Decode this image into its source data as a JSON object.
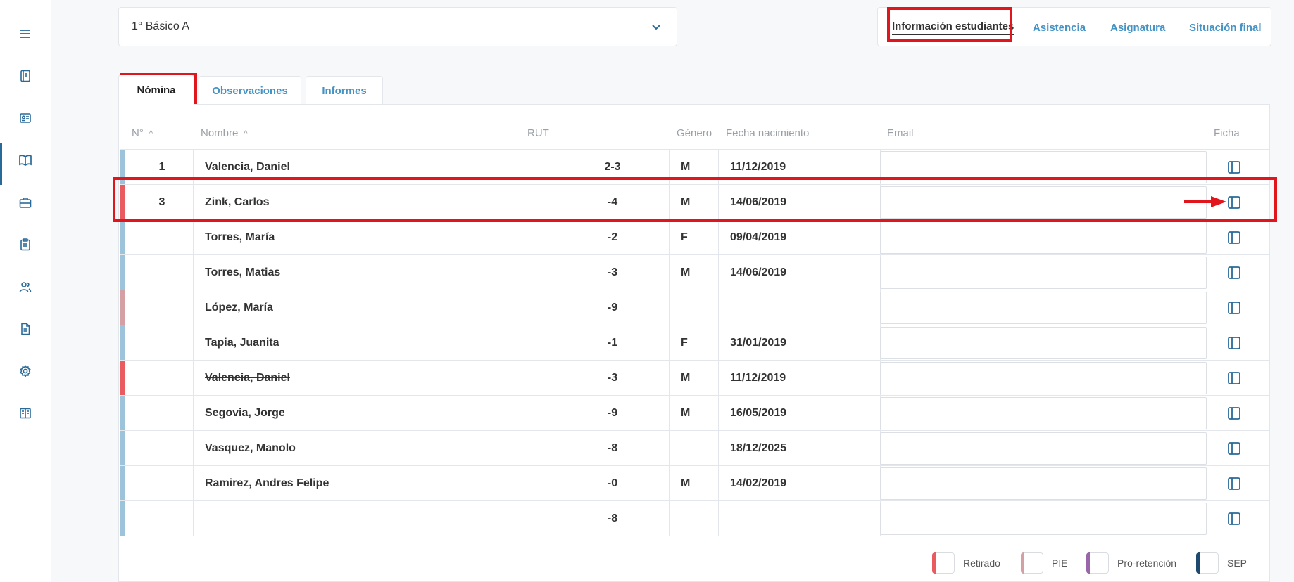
{
  "sidebar": {
    "items": [
      {
        "icon": "menu-icon"
      },
      {
        "icon": "notebook-icon"
      },
      {
        "icon": "id-card-icon"
      },
      {
        "icon": "book-open-icon"
      },
      {
        "icon": "briefcase-icon"
      },
      {
        "icon": "clipboard-icon"
      },
      {
        "icon": "users-icon"
      },
      {
        "icon": "document-icon"
      },
      {
        "icon": "gear-icon"
      },
      {
        "icon": "guide-book-icon"
      }
    ]
  },
  "course_select": {
    "value": "1° Básico A"
  },
  "top_tabs": [
    {
      "label": "Información estudiantes",
      "active": true
    },
    {
      "label": "Asistencia"
    },
    {
      "label": "Asignatura"
    },
    {
      "label": "Situación final"
    }
  ],
  "sub_tabs": [
    {
      "label": "Nómina",
      "active": true
    },
    {
      "label": "Observaciones"
    },
    {
      "label": "Informes"
    }
  ],
  "table": {
    "columns": {
      "n": "N°",
      "nombre": "Nombre",
      "rut": "RUT",
      "genero": "Género",
      "fecha": "Fecha nacimiento",
      "email": "Email",
      "ficha": "Ficha"
    },
    "rows": [
      {
        "n": "1",
        "nombre": "Valencia, Daniel",
        "rut": "2-3",
        "genero": "M",
        "fecha": "11/12/2019",
        "status": "normal"
      },
      {
        "n": "3",
        "nombre": "Zink, Carlos",
        "rut": "-4",
        "genero": "M",
        "fecha": "14/06/2019",
        "status": "retirado"
      },
      {
        "n": "",
        "nombre": "Torres, María",
        "rut": "-2",
        "genero": "F",
        "fecha": "09/04/2019",
        "status": "normal"
      },
      {
        "n": "",
        "nombre": "Torres, Matias",
        "rut": "-3",
        "genero": "M",
        "fecha": "14/06/2019",
        "status": "normal"
      },
      {
        "n": "",
        "nombre": "López, María",
        "rut": "-9",
        "genero": "",
        "fecha": "",
        "status": "pie"
      },
      {
        "n": "",
        "nombre": "Tapia, Juanita",
        "rut": "-1",
        "genero": "F",
        "fecha": "31/01/2019",
        "status": "normal"
      },
      {
        "n": "",
        "nombre": "Valencia, Daniel",
        "rut": "-3",
        "genero": "M",
        "fecha": "11/12/2019",
        "status": "retirado"
      },
      {
        "n": "",
        "nombre": "Segovia, Jorge",
        "rut": "-9",
        "genero": "M",
        "fecha": "16/05/2019",
        "status": "normal"
      },
      {
        "n": "",
        "nombre": "Vasquez, Manolo",
        "rut": "-8",
        "genero": "",
        "fecha": "18/12/2025",
        "status": "normal"
      },
      {
        "n": "",
        "nombre": "Ramirez, Andres Felipe",
        "rut": "-0",
        "genero": "M",
        "fecha": "14/02/2019",
        "status": "normal"
      },
      {
        "n": "",
        "nombre": "",
        "rut": "-8",
        "genero": "",
        "fecha": "",
        "status": "normal"
      }
    ]
  },
  "legend": [
    {
      "label": "Retirado",
      "color": "#e95b5f"
    },
    {
      "label": "PIE",
      "color": "#d4a0a3"
    },
    {
      "label": "Pro-retención",
      "color": "#9a66aa"
    },
    {
      "label": "SEP",
      "color": "#1d4a6e"
    }
  ],
  "colors": {
    "accent": "#4493c4",
    "sidebar_icon": "#2a6a98",
    "normal_bar": "#9dc3db",
    "highlight": "#e0161c"
  }
}
